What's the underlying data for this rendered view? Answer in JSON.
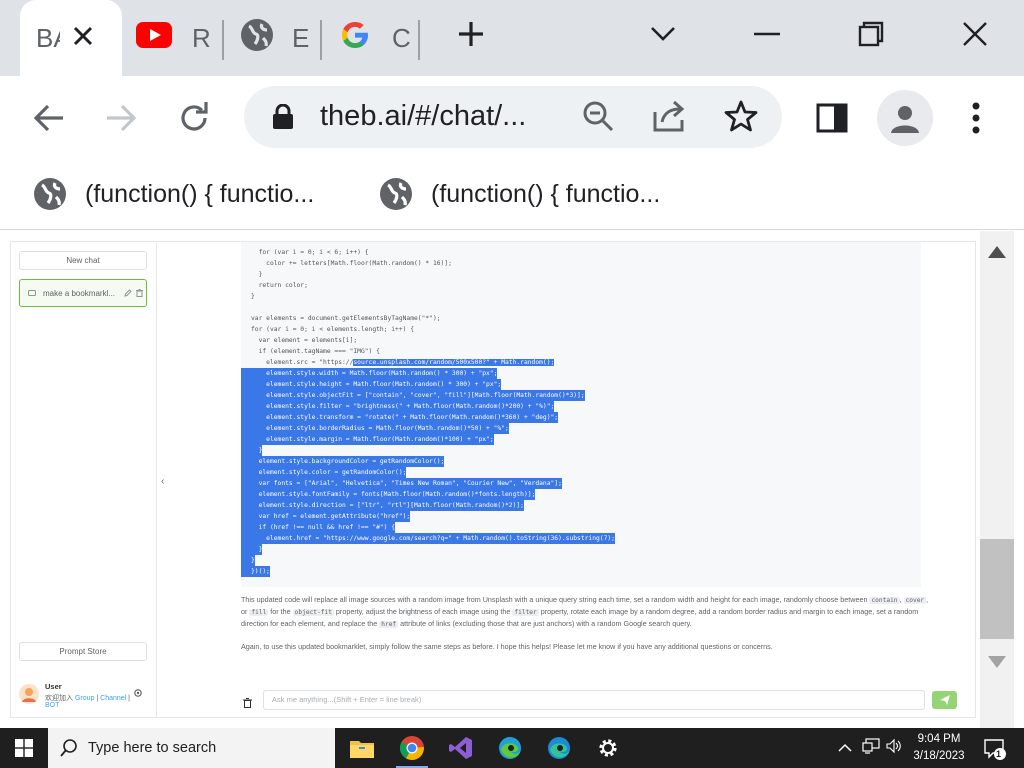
{
  "browser": {
    "tabs": [
      {
        "label": "BA",
        "active": true
      },
      {
        "label": "R",
        "active": false
      },
      {
        "label": "E",
        "active": false
      },
      {
        "label": "C",
        "active": false
      }
    ],
    "omnibox": {
      "url": "theb.ai/#/chat/..."
    },
    "bookmarks": [
      {
        "label": "(function() {  functio..."
      },
      {
        "label": "(function() {  functio..."
      }
    ]
  },
  "app": {
    "sidebar": {
      "new_chat_label": "New chat",
      "chat_item_title": "make a bookmarkl...",
      "prompt_store_label": "Prompt Store",
      "user_name": "User",
      "user_sub_prefix": "欢迎加入",
      "user_links": [
        "Group",
        "Channel",
        "BOT"
      ]
    },
    "code_lines": [
      {
        "text": "  for (var i = 0; i < 6; i++) {",
        "selected": false
      },
      {
        "text": "    color += letters[Math.floor(Math.random() * 16)];",
        "selected": false
      },
      {
        "text": "  }",
        "selected": false
      },
      {
        "text": "  return color;",
        "selected": false
      },
      {
        "text": "}",
        "selected": false
      },
      {
        "text": "",
        "selected": false
      },
      {
        "text": "var elements = document.getElementsByTagName(\"*\");",
        "selected": false
      },
      {
        "text": "for (var i = 0; i < elements.length; i++) {",
        "selected": false
      },
      {
        "text": "  var element = elements[i];",
        "selected": false
      },
      {
        "text": "  if (element.tagName === \"IMG\") {",
        "selected": false
      },
      {
        "text": "    element.src = \"https://source.unsplash.com/random/500x500?\" + Math.random();",
        "selected": "partial"
      },
      {
        "text": "    element.style.width = Math.floor(Math.random() * 300) + \"px\";",
        "selected": true
      },
      {
        "text": "    element.style.height = Math.floor(Math.random() * 300) + \"px\";",
        "selected": true
      },
      {
        "text": "    element.style.objectFit = [\"contain\", \"cover\", \"fill\"][Math.floor(Math.random()*3)];",
        "selected": true
      },
      {
        "text": "    element.style.filter = \"brightness(\" + Math.floor(Math.random()*200) + \"%)\";",
        "selected": true
      },
      {
        "text": "    element.style.transform = \"rotate(\" + Math.floor(Math.random()*360) + \"deg)\";",
        "selected": true
      },
      {
        "text": "    element.style.borderRadius = Math.floor(Math.random()*50) + \"%\";",
        "selected": true
      },
      {
        "text": "    element.style.margin = Math.floor(Math.random()*100) + \"px\";",
        "selected": true
      },
      {
        "text": "  }",
        "selected": true
      },
      {
        "text": "  element.style.backgroundColor = getRandomColor();",
        "selected": true
      },
      {
        "text": "  element.style.color = getRandomColor();",
        "selected": true
      },
      {
        "text": "  var fonts = [\"Arial\", \"Helvetica\", \"Times New Roman\", \"Courier New\", \"Verdana\"];",
        "selected": true
      },
      {
        "text": "  element.style.fontFamily = fonts[Math.floor(Math.random()*fonts.length)];",
        "selected": true
      },
      {
        "text": "  element.style.direction = [\"ltr\", \"rtl\"][Math.floor(Math.random()*2)];",
        "selected": true
      },
      {
        "text": "  var href = element.getAttribute(\"href\");",
        "selected": true
      },
      {
        "text": "  if (href !== null && href !== \"#\") {",
        "selected": true
      },
      {
        "text": "    element.href = \"https://www.google.com/search?q=\" + Math.random().toString(36).substring(7);",
        "selected": true
      },
      {
        "text": "  }",
        "selected": true
      },
      {
        "text": "}",
        "selected": true
      },
      {
        "text": "})();",
        "selected": true
      }
    ],
    "reply": {
      "p1_a": "This updated code will replace all image sources with a random image from Unsplash with a unique query string each time, set a random width and height for each image, randomly choose between ",
      "code_contain": "contain",
      "p1_b": ", ",
      "code_cover": "cover",
      "p1_c": ", or ",
      "code_fill": "fill",
      "p1_d": " for the ",
      "code_objectfit": "object-fit",
      "p1_e": " property, adjust the brightness of each image using the ",
      "code_filter": "filter",
      "p1_f": " property, rotate each image by a random degree, add a random border radius and margin to each image, set a random direction for each element, and replace the ",
      "code_href": "href",
      "p1_g": " attribute of links (excluding those that are just anchors) with a random Google search query.",
      "p2": "Again, to use this updated bookmarklet, simply follow the same steps as before. I hope this helps! Please let me know if you have any additional questions or concerns."
    },
    "input_placeholder": "Ask me anything...(Shift + Enter = line break)"
  },
  "taskbar": {
    "search_placeholder": "Type here to search",
    "time": "9:04 PM",
    "date": "3/18/2023",
    "notification_count": "1"
  }
}
